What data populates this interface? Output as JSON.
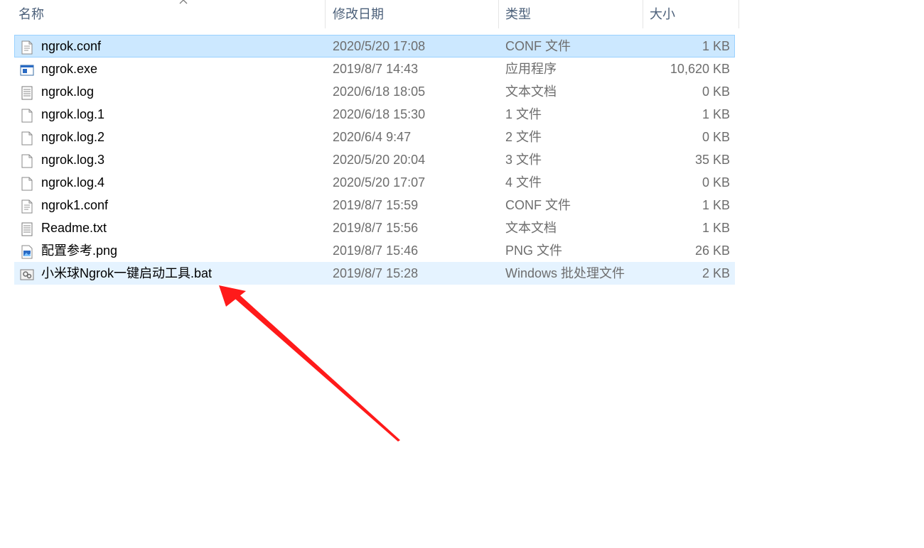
{
  "header": {
    "name": "名称",
    "date": "修改日期",
    "type": "类型",
    "size": "大小"
  },
  "files": [
    {
      "name": "ngrok.conf",
      "date": "2020/5/20 17:08",
      "type": "CONF 文件",
      "size": "1 KB",
      "icon": "text-file-icon",
      "state": "selected"
    },
    {
      "name": "ngrok.exe",
      "date": "2019/8/7 14:43",
      "type": "应用程序",
      "size": "10,620 KB",
      "icon": "application-icon",
      "state": ""
    },
    {
      "name": "ngrok.log",
      "date": "2020/6/18 18:05",
      "type": "文本文档",
      "size": "0 KB",
      "icon": "text-document-icon",
      "state": ""
    },
    {
      "name": "ngrok.log.1",
      "date": "2020/6/18 15:30",
      "type": "1 文件",
      "size": "1 KB",
      "icon": "blank-file-icon",
      "state": ""
    },
    {
      "name": "ngrok.log.2",
      "date": "2020/6/4 9:47",
      "type": "2 文件",
      "size": "0 KB",
      "icon": "blank-file-icon",
      "state": ""
    },
    {
      "name": "ngrok.log.3",
      "date": "2020/5/20 20:04",
      "type": "3 文件",
      "size": "35 KB",
      "icon": "blank-file-icon",
      "state": ""
    },
    {
      "name": "ngrok.log.4",
      "date": "2020/5/20 17:07",
      "type": "4 文件",
      "size": "0 KB",
      "icon": "blank-file-icon",
      "state": ""
    },
    {
      "name": "ngrok1.conf",
      "date": "2019/8/7 15:59",
      "type": "CONF 文件",
      "size": "1 KB",
      "icon": "text-file-icon",
      "state": ""
    },
    {
      "name": "Readme.txt",
      "date": "2019/8/7 15:56",
      "type": "文本文档",
      "size": "1 KB",
      "icon": "text-document-icon",
      "state": ""
    },
    {
      "name": "配置参考.png",
      "date": "2019/8/7 15:46",
      "type": "PNG 文件",
      "size": "26 KB",
      "icon": "image-file-icon",
      "state": ""
    },
    {
      "name": "小米球Ngrok一键启动工具.bat",
      "date": "2019/8/7 15:28",
      "type": "Windows 批处理文件",
      "size": "2 KB",
      "icon": "batch-file-icon",
      "state": "hover"
    }
  ],
  "colors": {
    "selected_bg": "#cce8ff",
    "hover_bg": "#e5f3ff",
    "arrow": "#ff1a1a"
  }
}
